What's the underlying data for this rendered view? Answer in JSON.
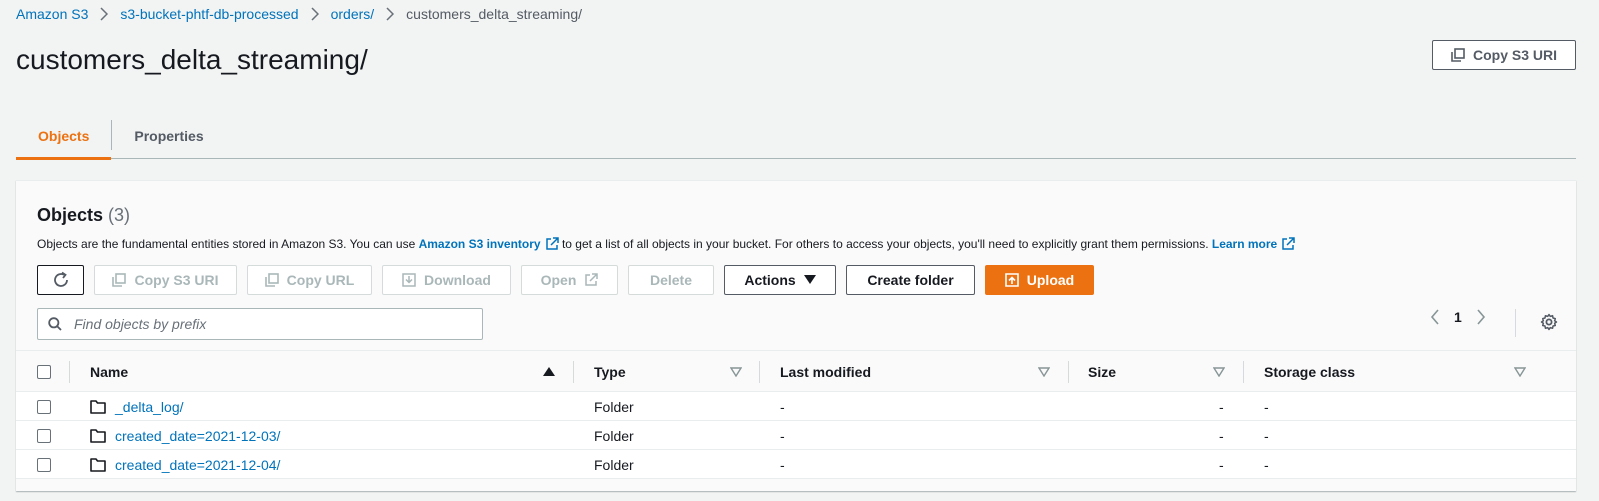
{
  "breadcrumb": {
    "items": [
      "Amazon S3",
      "s3-bucket-phtf-db-processed",
      "orders/"
    ],
    "current": "customers_delta_streaming/"
  },
  "page": {
    "title": "customers_delta_streaming/",
    "copy_uri_label": "Copy S3 URI"
  },
  "tabs": [
    {
      "label": "Objects",
      "active": true
    },
    {
      "label": "Properties",
      "active": false
    }
  ],
  "objects_panel": {
    "title": "Objects",
    "count": "(3)",
    "description_pre": "Objects are the fundamental entities stored in Amazon S3. You can use ",
    "inventory_link": "Amazon S3 inventory",
    "description_mid": " to get a list of all objects in your bucket. For others to access your objects, you'll need to explicitly grant them permissions. ",
    "learn_more": "Learn more",
    "toolbar": {
      "copy_s3_uri": "Copy S3 URI",
      "copy_url": "Copy URL",
      "download": "Download",
      "open": "Open",
      "delete": "Delete",
      "actions": "Actions",
      "create_folder": "Create folder",
      "upload": "Upload"
    },
    "search_placeholder": "Find objects by prefix",
    "pagination": {
      "current_page": "1"
    }
  },
  "table": {
    "columns": [
      "Name",
      "Type",
      "Last modified",
      "Size",
      "Storage class"
    ],
    "rows": [
      {
        "name": "_delta_log/",
        "type": "Folder",
        "last_modified": "-",
        "size": "-",
        "storage_class": "-"
      },
      {
        "name": "created_date=2021-12-03/",
        "type": "Folder",
        "last_modified": "-",
        "size": "-",
        "storage_class": "-"
      },
      {
        "name": "created_date=2021-12-04/",
        "type": "Folder",
        "last_modified": "-",
        "size": "-",
        "storage_class": "-"
      }
    ]
  },
  "colors": {
    "accent": "#ec7211",
    "link": "#0073bb",
    "background": "#f2f3f3"
  }
}
